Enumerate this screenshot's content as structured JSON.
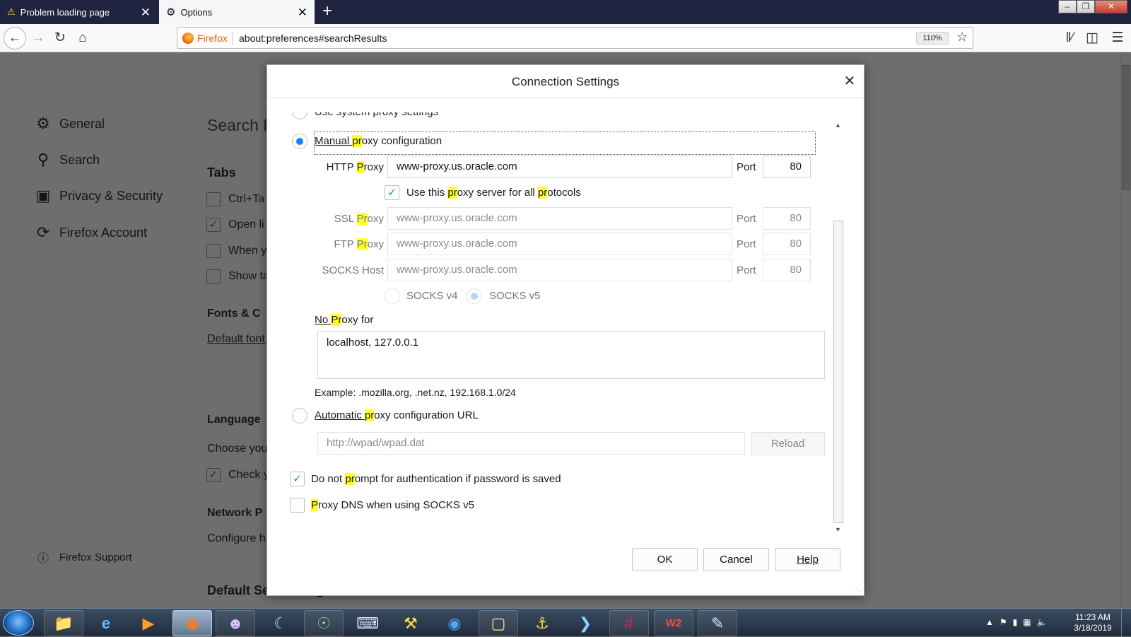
{
  "browser": {
    "tabs": [
      {
        "title": "Problem loading page",
        "icon": "warning-icon"
      },
      {
        "title": "Options",
        "icon": "gear-icon"
      }
    ],
    "url_brand": "Firefox",
    "url": "about:preferences#searchResults",
    "zoom": "110%",
    "win_buttons": {
      "minimize": "–",
      "restore": "❐",
      "close": "✕"
    }
  },
  "prefs": {
    "nav": [
      {
        "label": "General",
        "icon": "gear-icon"
      },
      {
        "label": "Search",
        "icon": "search-icon"
      },
      {
        "label": "Privacy & Security",
        "icon": "lock-icon"
      },
      {
        "label": "Firefox Account",
        "icon": "sync-icon"
      }
    ],
    "support": "Firefox Support",
    "search_heading": "Search R",
    "tabs_heading": "Tabs",
    "tab_items": [
      {
        "text": "Ctrl+Ta",
        "checked": false
      },
      {
        "text": "Open li",
        "checked": true
      },
      {
        "text": "When y",
        "checked": false
      },
      {
        "text": "Show ta",
        "checked": false
      }
    ],
    "fonts_heading": "Fonts & C",
    "default_font": "Default font",
    "language_heading": "Language",
    "choose_text": "Choose you",
    "check_text": "Check y",
    "network_heading": "Network P",
    "configure_text": "Configure h",
    "default_engine": "Default Search Engine"
  },
  "dialog": {
    "title": "Connection Settings",
    "top_partial": "Use system proxy settings",
    "manual": {
      "pre": "Manual ",
      "hl": "pr",
      "post": "oxy configuration"
    },
    "http": {
      "label_pre": "HTTP ",
      "label_hl": "P",
      "label_post": "roxy",
      "value": "www-proxy.us.oracle.com",
      "port_label": "Port",
      "port": "80"
    },
    "use_all": {
      "pre": "Use this ",
      "hl1": "pr",
      "mid": "oxy server for all ",
      "hl2": "pr",
      "post": "otocols"
    },
    "ssl": {
      "label_pre": "SSL ",
      "label_hl": "Pr",
      "label_post": "oxy",
      "value": "www-proxy.us.oracle.com",
      "port_label": "Port",
      "port": "80"
    },
    "ftp": {
      "label_pre": "FTP ",
      "label_hl": "Pr",
      "label_post": "oxy",
      "value": "www-proxy.us.oracle.com",
      "port_label": "Port",
      "port": "80"
    },
    "socks": {
      "label": "SOCKS Host",
      "value": "www-proxy.us.oracle.com",
      "port_label": "Port",
      "port": "80"
    },
    "socks_v4": "SOCKS v4",
    "socks_v5": "SOCKS v5",
    "no_proxy": {
      "pre": "No ",
      "hl": "Pr",
      "post": "oxy for"
    },
    "no_proxy_value": "localhost, 127.0.0.1",
    "example": "Example: .mozilla.org, .net.nz, 192.168.1.0/24",
    "auto": {
      "pre": "Automatic ",
      "hl": "pr",
      "post": "oxy configuration URL"
    },
    "auto_url_placeholder": "http://wpad/wpad.dat",
    "reload": "Reload",
    "no_prompt": {
      "pre": "Do not ",
      "hl": "pr",
      "post": "ompt for authentication if password is saved"
    },
    "proxy_dns": {
      "hl": "P",
      "post": "roxy DNS when using SOCKS v5"
    },
    "ok": "OK",
    "cancel": "Cancel",
    "help": "Help",
    "accent": "#0a84ff",
    "highlight": "#ffff30"
  },
  "taskbar": {
    "clock_time": "11:23 AM",
    "clock_date": "3/18/2019"
  }
}
